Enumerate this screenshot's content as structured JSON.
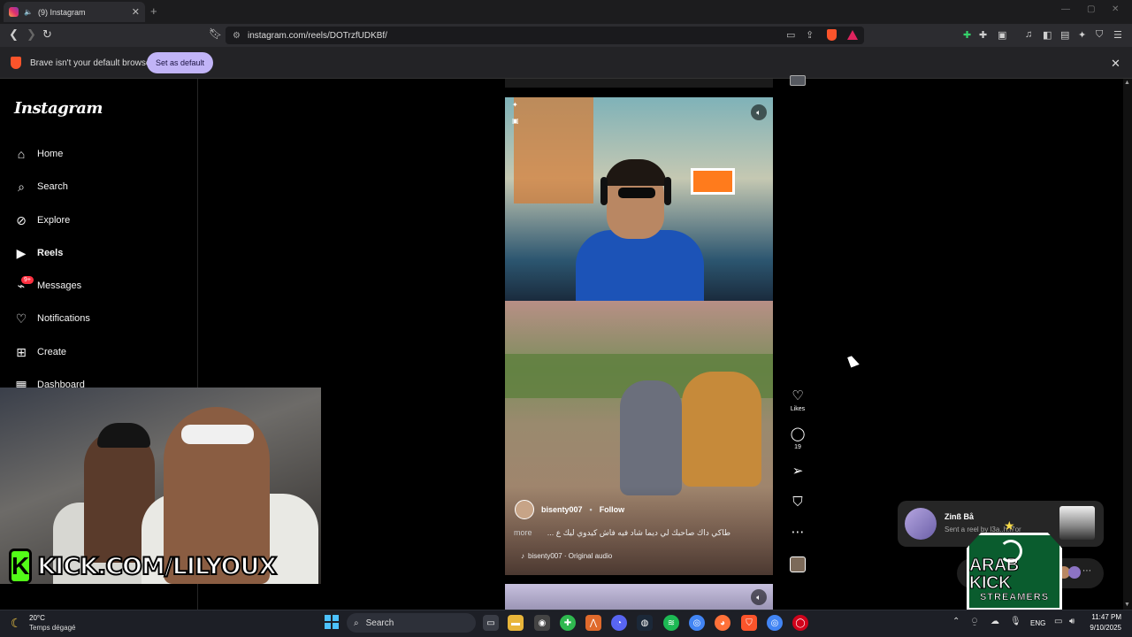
{
  "browser": {
    "tab_title": "(9) Instagram",
    "new_tab": "+",
    "tab_close": "✕",
    "url": "instagram.com/reels/DOTrzfUDKBf/",
    "window_controls": [
      "—",
      "▢",
      "✕"
    ],
    "infobar_text": "Brave isn't your default browser",
    "set_default_label": "Set as default",
    "infobar_close": "✕"
  },
  "sidebar": {
    "logo": "Instagram",
    "items": [
      {
        "label": "Home",
        "icon": "home-icon"
      },
      {
        "label": "Search",
        "icon": "search-icon"
      },
      {
        "label": "Explore",
        "icon": "compass-icon"
      },
      {
        "label": "Reels",
        "icon": "reels-icon"
      },
      {
        "label": "Messages",
        "icon": "messenger-icon"
      },
      {
        "label": "Notifications",
        "icon": "heart-icon"
      },
      {
        "label": "Create",
        "icon": "plus-square-icon"
      },
      {
        "label": "Dashboard",
        "icon": "dashboard-icon"
      }
    ],
    "messages_badge": "9+"
  },
  "overlay": {
    "kick_letter": "K",
    "kick_url": "KICK.COM/LILYOUX",
    "badge_line1": "ARAB KICK",
    "badge_line2": "STREAMERS"
  },
  "reel": {
    "username": "bisenty007",
    "dot": "•",
    "follow_label": "Follow",
    "caption": "طاكي داك صاحبك لي ديما شاد فيه فاش كيدوي ليك ع ...",
    "more_label": "more",
    "audio": "bisenty007 · Original audio",
    "likes_label": "Likes",
    "comments_count": "19"
  },
  "toast": {
    "name": "Zinß Bå",
    "subtitle": "Sent a reel by l3a..h.l7or"
  },
  "taskbar": {
    "temperature": "20°C",
    "weather": "Temps dégagé",
    "search_label": "Search",
    "language": "ENG",
    "time": "11:47 PM",
    "date": "9/10/2025"
  },
  "colors": {
    "accent_set_default": "#c1b4f7",
    "kick_green": "#53fc18",
    "badge_red": "#ff3040",
    "arab_kick_green": "#0a5c2e"
  }
}
